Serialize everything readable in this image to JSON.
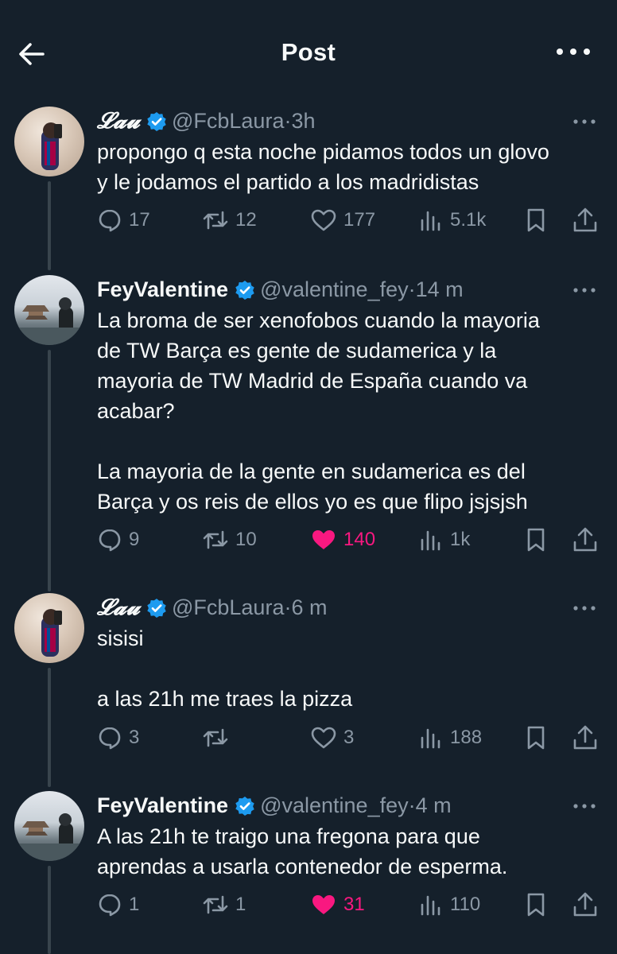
{
  "header": {
    "title": "Post"
  },
  "tweets": [
    {
      "name": "𝓛𝓪𝓾",
      "handle": "@FcbLaura",
      "sep": "·",
      "time": "3h",
      "text": "propongo q esta noche pidamos todos un glovo\ny le jodamos el partido a los madridistas",
      "replies": "17",
      "retweets": "12",
      "likes": "177",
      "liked": false,
      "views": "5.1k"
    },
    {
      "name": "FeyValentine",
      "handle": "@valentine_fey",
      "sep": "·",
      "time": "14 m",
      "text": "La broma de ser xenofobos cuando la mayoria\nde TW Barça es gente de sudamerica y la\nmayoria de TW Madrid de España cuando va\nacabar?\n\nLa mayoria de la gente en sudamerica es del\nBarça y os reis de ellos yo es que flipo jsjsjsh",
      "replies": "9",
      "retweets": "10",
      "likes": "140",
      "liked": true,
      "views": "1k"
    },
    {
      "name": "𝓛𝓪𝓾",
      "handle": "@FcbLaura",
      "sep": "·",
      "time": "6 m",
      "text": "sisisi\n\na las 21h me traes la pizza",
      "replies": "3",
      "retweets": "",
      "likes": "3",
      "liked": false,
      "views": "188"
    },
    {
      "name": "FeyValentine",
      "handle": "@valentine_fey",
      "sep": "·",
      "time": "4 m",
      "text": "A las 21h te traigo una fregona para que\naprendas a usarla contenedor de esperma.",
      "replies": "1",
      "retweets": "1",
      "likes": "31",
      "liked": true,
      "views": "110"
    }
  ],
  "icons": {
    "back": "arrow-left-icon",
    "more": "more-horizontal-icon",
    "verified": "verified-badge-icon",
    "reply": "reply-icon",
    "retweet": "retweet-icon",
    "like": "heart-icon",
    "views": "views-icon",
    "bookmark": "bookmark-icon",
    "share": "share-icon"
  },
  "colors": {
    "background": "#15202b",
    "text": "#f7f9f9",
    "muted": "#8b98a5",
    "verified": "#1d9bf0",
    "like": "#f91880",
    "thread": "#38444d"
  }
}
